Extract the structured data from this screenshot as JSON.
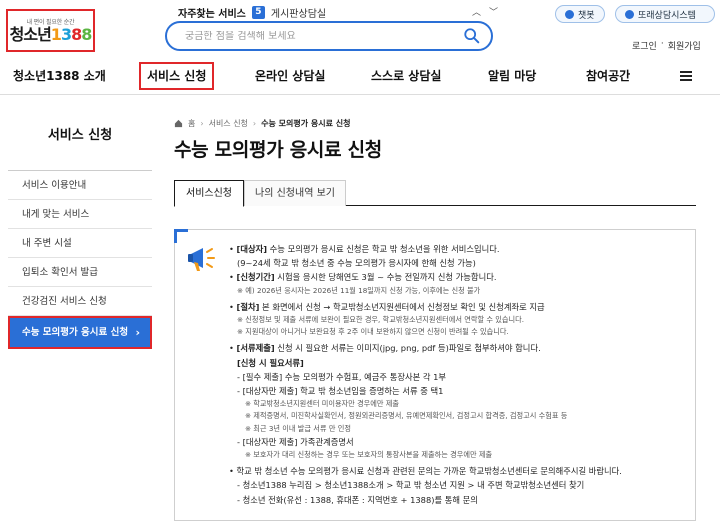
{
  "logo": {
    "tagline": "내 편이 필요한 순간",
    "text_a": "청소년",
    "n1": "1",
    "n2": "3",
    "n3": "8",
    "n4": "8"
  },
  "header": {
    "faq_label": "자주찾는 서비스",
    "faq_number": "5",
    "faq_item": "게시판상담실",
    "search_placeholder": "궁금한 점을 검색해 보세요",
    "chatbot": "챗봇",
    "peer_counsel": "또래상담시스템",
    "login": "로그인",
    "dot": "·",
    "signup": "회원가입"
  },
  "nav": [
    {
      "label": "청소년1388 소개"
    },
    {
      "label": "서비스 신청"
    },
    {
      "label": "온라인 상담실"
    },
    {
      "label": "스스로 상담실"
    },
    {
      "label": "알림 마당"
    },
    {
      "label": "참여공간"
    }
  ],
  "sidebar": {
    "title": "서비스 신청",
    "items": [
      {
        "label": "서비스 이용안내"
      },
      {
        "label": "내게 맞는 서비스"
      },
      {
        "label": "내 주변 시설"
      },
      {
        "label": "입퇴소 확인서 발급"
      },
      {
        "label": "건강검진 서비스 신청"
      },
      {
        "label": "수능 모의평가 응시료 신청"
      }
    ]
  },
  "breadcrumb": {
    "home": "홈",
    "level1": "서비스 신청",
    "current": "수능 모의평가 응시료 신청"
  },
  "page_title": "수능 모의평가 응시료 신청",
  "tabs": [
    {
      "label": "서비스신청"
    },
    {
      "label": "나의 신청내역 보기"
    }
  ],
  "info": {
    "l1_bullet": "•",
    "l1_key": "[대상자]",
    "l1_text": " 수능 모의평가 응시료 신청은 학교 밖 청소년을 위한 서비스입니다.",
    "l2": "(9~24세 학교 밖 청소년 중 수능 모의평가 응시자에 한해 신청 가능)",
    "l3_key": "[신청기간]",
    "l3_text": " 시험을 응시한 당해연도 3월 ~ 수능 전일까지 신청 가능합니다.",
    "l4": "※ 예) 2026년 응시자는 2026년 11월 18일까지 신청 가능, 이후에는 신청 불가",
    "l5_key": "[절차]",
    "l5_text": " 본 화면에서 신청 → 학교밖청소년지원센터에서 신청정보 확인 및 신청계좌로 지급",
    "l6": "※ 신청정보 및 제출 서류에 보완이 필요한 경우, 학교밖청소년지원센터에서 연락할 수 있습니다.",
    "l7": "※ 지원대상이 아니거나 보완요청 후 2주 이내 보완하지 않으면 신청이 반려될 수 있습니다.",
    "l8_key": "[서류제출]",
    "l8_text": " 신청 시 필요한 서류는 이미지(jpg, png, pdf 등)파일로 첨부하셔야 합니다.",
    "l9": "[신청 시 필요서류]",
    "l10": "- [필수 제출] 수능 모의평가 수험표, 예금주 통장사본 각 1부",
    "l11": "- [대상자만 제출] 학교 밖 청소년임을 증명하는 서류 중 택1",
    "l12": "※ 학교밖청소년지원센터 미이용자만 경우에만 제출",
    "l13": "※ 제적증명서, 미진학사실확인서, 정원외관리증명서, 유예면제확인서, 검정고시 합격증, 검정고시 수험표 등",
    "l14": "※ 최근 3년 이내 발급 서류 만 인정",
    "l15": "- [대상자만 제출] 가족관계증명서",
    "l16": "※ 보호자가 대리 신청하는 경우 또는 보호자의 통장사본을 제출하는 경우에만 제출",
    "l17": "• 학교 밖 청소년 수능 모의평가 응시료 신청과 관련된 문의는 가까운 학교밖청소년센터로 문의해주시길 바랍니다.",
    "l18": "- 청소년1388 누리집 > 청소년1388소개 > 학교 밖 청소년 지원 > 내 주변 학교밖청소년센터 찾기",
    "l19": "- 청소년 전화(유선 : 1388, 휴대폰 : 지역번호 + 1388)를 통해 문의"
  },
  "colors": {
    "brand_blue": "#2a6fd6",
    "highlight_red": "#e0272a"
  }
}
